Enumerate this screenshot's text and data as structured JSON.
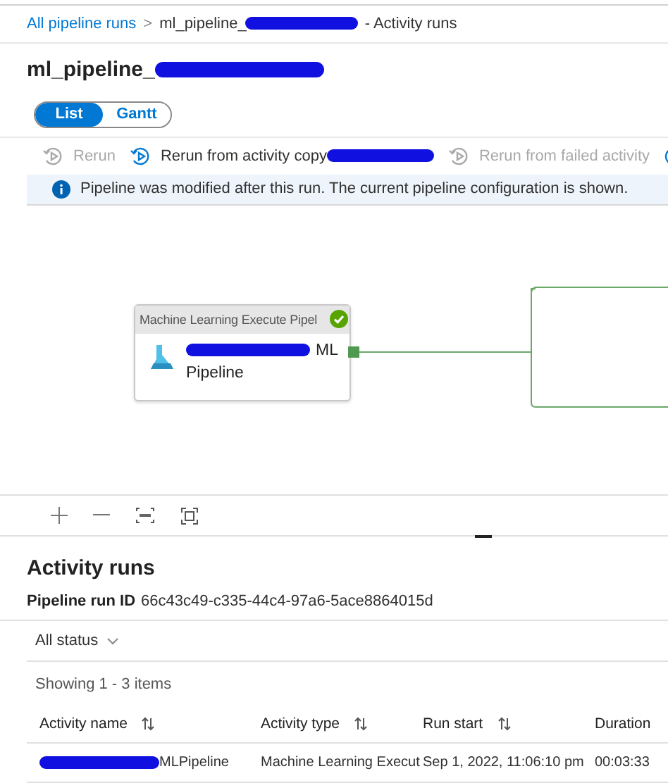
{
  "breadcrumb": {
    "link": "All pipeline runs",
    "separator": ">",
    "current_prefix": "ml_pipeline_",
    "current_suffix": "- Activity runs"
  },
  "title": "ml_pipeline_",
  "view_tabs": [
    {
      "label": "List",
      "selected": true
    },
    {
      "label": "Gantt",
      "selected": false
    }
  ],
  "toolbar": [
    {
      "label": "Rerun",
      "disabled": true,
      "redacted": false
    },
    {
      "label": "Rerun from activity copy",
      "disabled": false,
      "redacted": true
    },
    {
      "label": "Rerun from failed activity",
      "disabled": true,
      "redacted": false
    }
  ],
  "info_bar": {
    "message": "Pipeline was modified after this run. The current pipeline configuration is shown."
  },
  "activity_node": {
    "type_label": "Machine Learning Execute Pipel",
    "succeeded": true,
    "name_suffix": "ML",
    "name_line2": "Pipeline"
  },
  "activity_runs": {
    "heading": "Activity runs",
    "run_id_label": "Pipeline run ID",
    "run_id": "66c43c49-c335-44c4-97a6-5ace8864015d",
    "status_filter": "All status",
    "showing": "Showing 1 - 3 items",
    "columns": [
      {
        "label": "Activity name",
        "sortable": true
      },
      {
        "label": "Activity type",
        "sortable": true
      },
      {
        "label": "Run start",
        "sortable": true
      },
      {
        "label": "Duration",
        "sortable": false
      }
    ],
    "rows": [
      {
        "name_suffix": "MLPipeline",
        "activity_type": "Machine Learning Execut",
        "run_start": "Sep 1, 2022, 11:06:10 pm",
        "duration": "00:03:33"
      }
    ]
  }
}
